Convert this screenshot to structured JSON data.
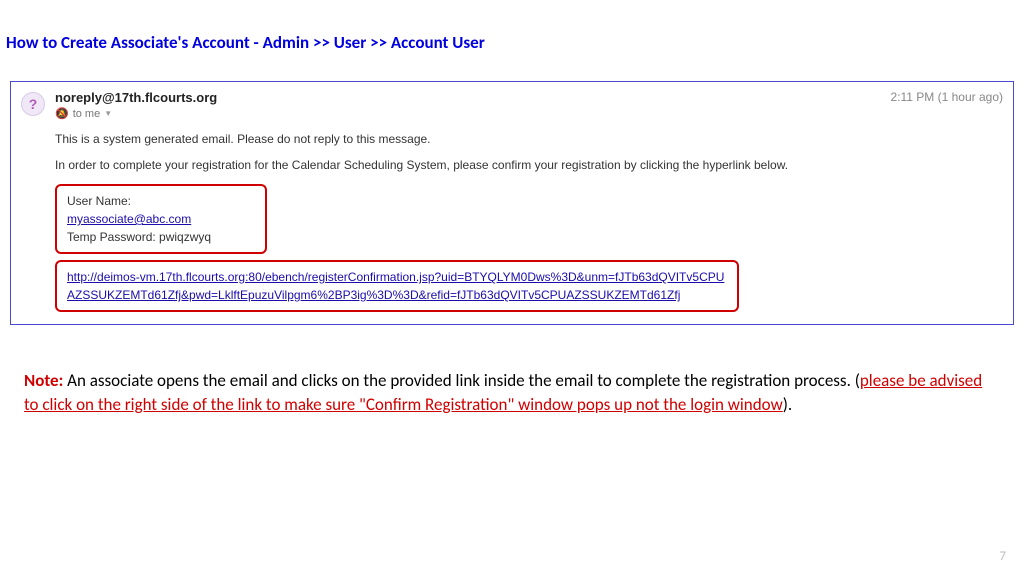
{
  "title": "How to Create Associate's Account  - Admin >> User >> Account User",
  "email": {
    "avatar_char": "?",
    "sender": "noreply@17th.flcourts.org",
    "to_text": "to me",
    "timestamp": "2:11 PM (1 hour ago)",
    "body_line1": "This is a system generated email. Please do not reply to this message.",
    "body_line2": "In order to complete your registration for the Calendar Scheduling System, please confirm your registration by clicking the hyperlink below.",
    "credentials": {
      "username_label": "User Name:",
      "username_value": "myassociate@abc.com",
      "password_label": "Temp Password:",
      "password_value": "pwiqzwyq"
    },
    "confirmation_link": "http://deimos-vm.17th.flcourts.org:80/ebench/registerConfirmation.jsp?uid=BTYQLYM0Dws%3D&unm=fJTb63dQVITv5CPUAZSSUKZEMTd61Zfj&pwd=LklftEpuzuVilpgm6%2BP3ig%3D%3D&refid=fJTb63dQVITv5CPUAZSSUKZEMTd61Zfj"
  },
  "note": {
    "label": "Note:",
    "text_before": " An associate opens the email and clicks on the provided link inside the email to complete the registration process. (",
    "warning": "please be advised to click on the right side of the link to make sure \"Confirm Registration\" window pops up not the login window",
    "text_after": ")."
  },
  "page_number": "7"
}
